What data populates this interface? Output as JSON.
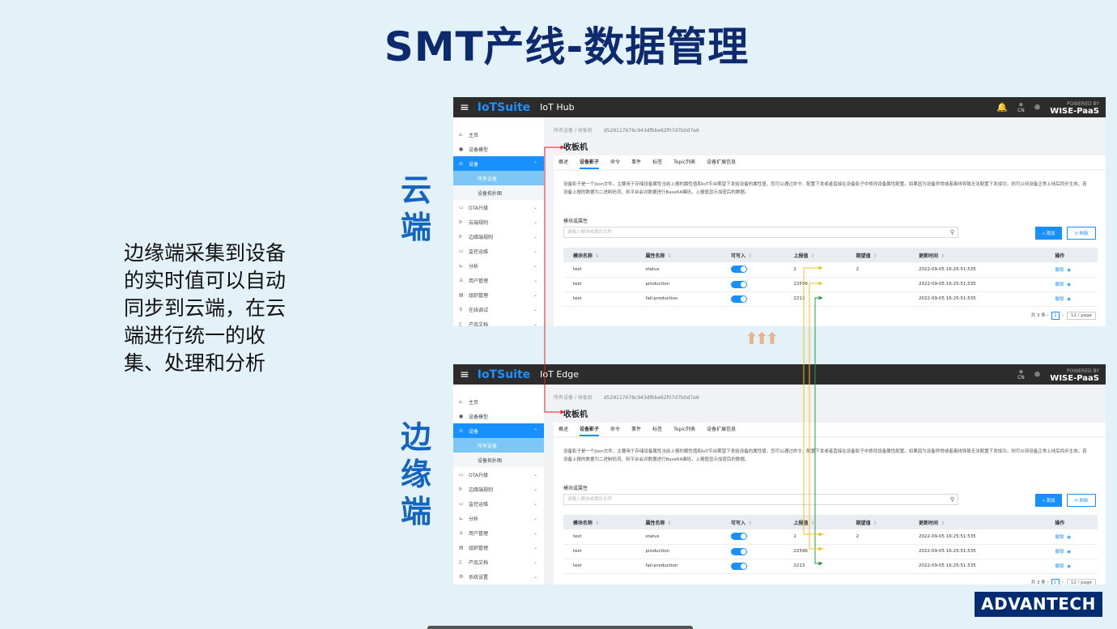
{
  "slide": {
    "title": "SMT产线-数据管理",
    "description": "边缘端采集到设备的实时值可以自动同步到云端，在云端进行统一的收集、处理和分析",
    "cloud_label": "云端",
    "edge_label": "边缘端",
    "sync_arrows": "⬆⬆⬆",
    "logo_text": "ADVANTECH"
  },
  "cloud": {
    "brand": "IoTSuite",
    "app_name": "IoT Hub",
    "lang": "CN",
    "powered_by": "POWERED BY",
    "platform": "WISE-PaaS",
    "nav": [
      {
        "label": "主页",
        "icon": "home-icon",
        "glyph": "⌂"
      },
      {
        "label": "设备模型",
        "icon": "model-icon",
        "glyph": "●"
      },
      {
        "label": "设备",
        "icon": "device-icon",
        "glyph": "⊙",
        "active": true
      },
      {
        "label": "所有设备",
        "sub": true,
        "selected": true
      },
      {
        "label": "设备拓扑图",
        "sub": true
      },
      {
        "label": "OTA升级",
        "icon": "ota-icon",
        "glyph": "▭"
      },
      {
        "label": "云端规则",
        "icon": "rule-icon",
        "glyph": "⊪"
      },
      {
        "label": "边缘端规则",
        "icon": "rule-icon",
        "glyph": "⊪"
      },
      {
        "label": "监控运维",
        "icon": "monitor-icon",
        "glyph": "▭"
      },
      {
        "label": "分析",
        "icon": "chart-icon",
        "glyph": "⊾"
      },
      {
        "label": "用户管理",
        "icon": "user-icon",
        "glyph": "♙"
      },
      {
        "label": "组织管理",
        "icon": "org-icon",
        "glyph": "▤"
      },
      {
        "label": "在线调试",
        "icon": "debug-icon",
        "glyph": "⚲"
      },
      {
        "label": "产品文档",
        "icon": "doc-icon",
        "glyph": "▯"
      }
    ]
  },
  "edge": {
    "brand": "IoTSuite",
    "app_name": "IoT Edge",
    "lang": "CN",
    "powered_by": "POWERED BY",
    "platform": "WISE-PaaS",
    "nav": [
      {
        "label": "主页",
        "icon": "home-icon",
        "glyph": "⌂"
      },
      {
        "label": "设备模型",
        "icon": "model-icon",
        "glyph": "●"
      },
      {
        "label": "设备",
        "icon": "device-icon",
        "glyph": "⊙",
        "active": true
      },
      {
        "label": "所有设备",
        "sub": true,
        "selected": true
      },
      {
        "label": "设备拓扑图",
        "sub": true
      },
      {
        "label": "OTA升级",
        "icon": "ota-icon",
        "glyph": "▭"
      },
      {
        "label": "边缘端规则",
        "icon": "rule-icon",
        "glyph": "⊪"
      },
      {
        "label": "监控运维",
        "icon": "monitor-icon",
        "glyph": "▭"
      },
      {
        "label": "分析",
        "icon": "chart-icon",
        "glyph": "⊾"
      },
      {
        "label": "用户管理",
        "icon": "user-icon",
        "glyph": "♙"
      },
      {
        "label": "组织管理",
        "icon": "org-icon",
        "glyph": "▤"
      },
      {
        "label": "产品文档",
        "icon": "doc-icon",
        "glyph": "▯"
      },
      {
        "label": "系统设置",
        "icon": "settings-icon",
        "glyph": "⚙"
      }
    ]
  },
  "device": {
    "breadcrumb_all": "所有设备",
    "breadcrumb_sep": "/",
    "breadcrumb_name": "收板机",
    "device_id": "d529117676c943dfbbe62f07d7b0d7e6",
    "title": "收板机",
    "tabs": [
      "概述",
      "设备影子",
      "命令",
      "事件",
      "标签",
      "Topic列表",
      "设备扩展信息"
    ],
    "active_tab": 1,
    "description": "设备影子是一个Json文件，主要用于存储设备属性当前上报的属性值和IoT平台期望下发给设备的属性值，您可以通过命令、配置下发或者直接在设备影子中修改设备属性配置。如果因为设备异常或者离线导致无法配置下发成功，则可以待设备正常上线后同步生效。若设备上报的数据为二进制码流，则平台会对数据进行Base64编码，上报值显示加密后的数据。",
    "filter_label": "模块或属性",
    "search_placeholder": "请输入模块或属性名称",
    "add_label": "+ 添加",
    "refresh_label": "⟳ 刷新",
    "columns": [
      "模块名称",
      "属性名称",
      "可写入",
      "上报值",
      "期望值",
      "更新时间",
      "操作"
    ],
    "rows": [
      {
        "module": "test",
        "property": "status",
        "reported": "2",
        "desired": "2",
        "time": "2022-09-05 16:25:51:535"
      },
      {
        "module": "test",
        "property": "production",
        "reported": "22596",
        "desired": "",
        "time": "2022-09-05 16:25:51:535"
      },
      {
        "module": "test",
        "property": "fail-production",
        "reported": "2213",
        "desired": "",
        "time": "2022-09-05 16:25:51:535"
      }
    ],
    "action_label": "撤销",
    "total_label": "共 3 条",
    "page": "1",
    "page_size": "12 / page"
  },
  "colors": {
    "title": "#0d2a6e",
    "accent": "#1890ff",
    "vertical_label": "#1565c0",
    "arrow_red": "#e02020",
    "arrow_yellow": "#f0c020",
    "arrow_green": "#22a040"
  }
}
